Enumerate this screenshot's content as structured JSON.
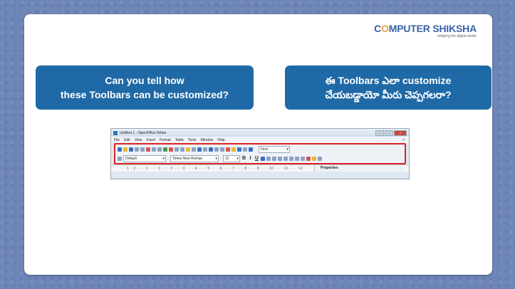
{
  "logo": {
    "brand_pre": "C",
    "brand_o": "O",
    "brand_post": "MPUTER SHIKSHA",
    "tagline": "bridging the digital divide"
  },
  "question_en": {
    "line1": "Can you tell how",
    "line2": "these Toolbars can be customized?"
  },
  "question_te": {
    "line1": "ఈ Toolbars ఎలా customize",
    "line2": "చేయబడ్డాయో మీరు చెప్పగలరా?"
  },
  "writer": {
    "title": "Untitled 1 - OpenOffice Writer",
    "menu": [
      "File",
      "Edit",
      "View",
      "Insert",
      "Format",
      "Table",
      "Tools",
      "Window",
      "Help"
    ],
    "menu_close": "×",
    "find_placeholder": "Find",
    "style_value": "Default",
    "font_value": "Times New Roman",
    "size_value": "12",
    "bold": "B",
    "italic": "I",
    "underline": "U",
    "ruler": "· · 1 · 2 · · · 1 · · · 1 · · · 2 · · · 3 · · · 4 · · · 5 · · · 6 · · · 7 · · · 8 · · · 9 · · · 10 · · · 11 · · · 12 ·",
    "properties_label": "Properties"
  }
}
